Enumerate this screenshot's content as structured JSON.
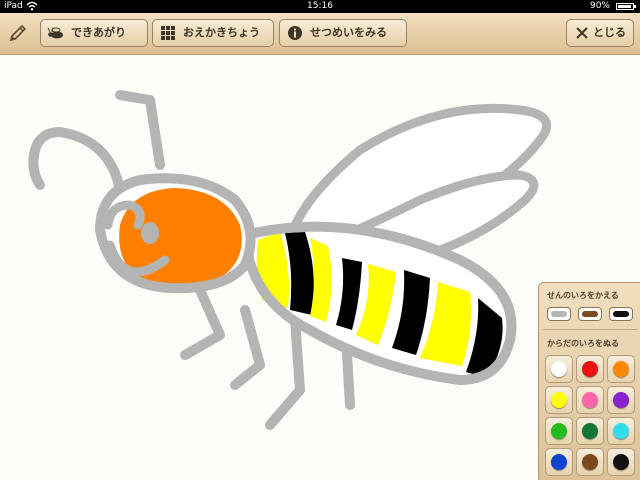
{
  "statusbar": {
    "device": "iPad",
    "time": "15:16",
    "battery_text": "90%",
    "battery_level": 0.9
  },
  "toolbar": {
    "pencil_icon": "pencil-icon",
    "done_label": "できあがり",
    "sketchbook_label": "おえかきちょう",
    "help_label": "せつめいをみる",
    "close_label": "とじる"
  },
  "drawing": {
    "subject": "bee",
    "colors": {
      "outline": "#b4b4b4",
      "head": "#ff8000",
      "stripe_yellow": "#ffff00",
      "stripe_black": "#000000"
    }
  },
  "palette": {
    "line_title": "せんのいろをかえる",
    "line_colors": [
      "#b4b4b4",
      "#7a4a1e",
      "#111111"
    ],
    "fill_title": "からだのいろをぬる",
    "fill_colors": [
      "#ffffff",
      "#ee1111",
      "#ff8800",
      "#ffff00",
      "#ff66aa",
      "#8822cc",
      "#22bb22",
      "#117733",
      "#33ddee",
      "#1144cc",
      "#7a4a1e",
      "#111111"
    ]
  }
}
